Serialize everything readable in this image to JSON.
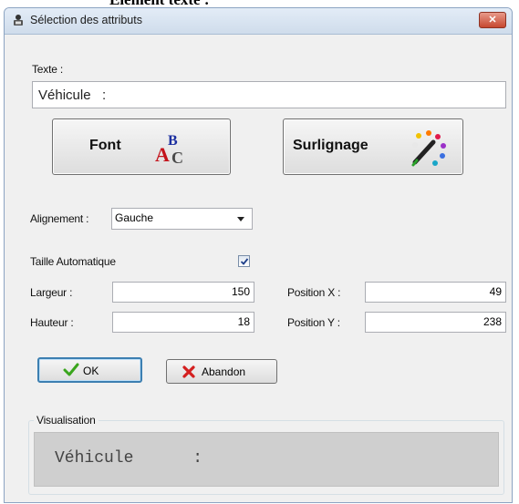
{
  "document": {
    "heading": "Elément texte :"
  },
  "window": {
    "title": "Sélection des attributs",
    "close_symbol": "✕"
  },
  "texte": {
    "label": "Texte :",
    "value": "Véhicule   :"
  },
  "buttons": {
    "font_label": "Font",
    "surlignage_label": "Surlignage",
    "ok_label": "OK",
    "abandon_label": "Abandon"
  },
  "alignement": {
    "label": "Alignement :",
    "selected": "Gauche"
  },
  "taille_auto": {
    "label": "Taille Automatique",
    "checked": true
  },
  "largeur": {
    "label": "Largeur :",
    "value": "150"
  },
  "hauteur": {
    "label": "Hauteur :",
    "value": "18"
  },
  "position_x": {
    "label": "Position X :",
    "value": "49"
  },
  "position_y": {
    "label": "Position Y :",
    "value": "238"
  },
  "visualisation": {
    "title": "Visualisation",
    "preview_text": "Véhicule      :"
  },
  "colors": {
    "ok_check": "#3aa51d",
    "abandon_x": "#d41f1f",
    "accent_focus": "#3c7fb1"
  },
  "icons": [
    "app-icon",
    "close-icon",
    "font-abc-icon",
    "highlight-pen-icon",
    "checkmark-icon",
    "cross-icon",
    "dropdown-arrow-icon"
  ]
}
